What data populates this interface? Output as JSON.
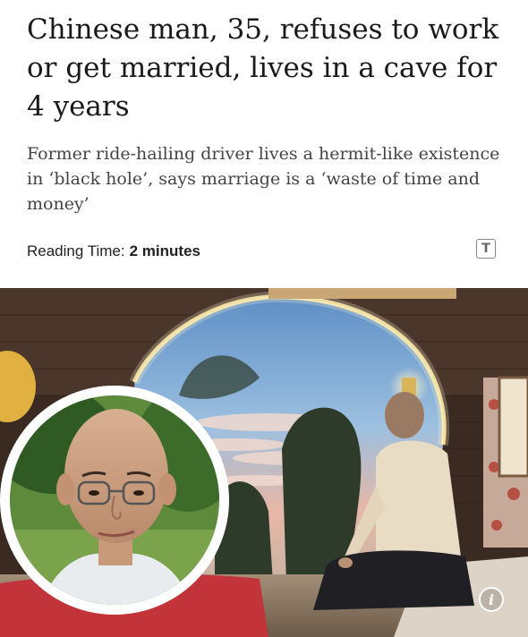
{
  "article": {
    "headline": "Chinese man, 35, refuses to work or get married, lives in a cave for 4 years",
    "subheadline": "Former ride-hailing driver lives a hermit-like existence in ‘black hole’, says marriage is a ‘waste of time and money’",
    "reading_time_label": "Reading Time:",
    "reading_time_value": "2 minutes"
  },
  "icons": {
    "text_size": "text-size-icon",
    "info": "info-icon"
  },
  "colors": {
    "headline": "#1a1a1a",
    "subheadline": "#444444",
    "photo_frame": "#ffffff"
  }
}
